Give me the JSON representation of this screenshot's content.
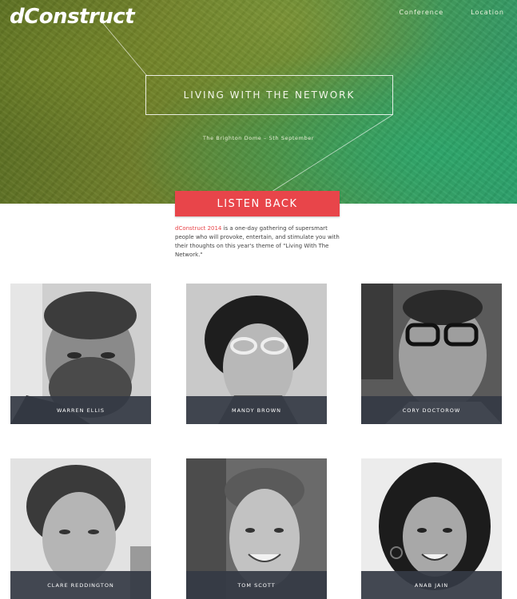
{
  "header": {
    "logo": "dConstruct",
    "nav": [
      {
        "label": "Conference"
      },
      {
        "label": "Location"
      }
    ]
  },
  "hero": {
    "title": "LIVING WITH THE NETWORK",
    "subtitle": "The Brighton Dome – 5th September",
    "cta_label": "LISTEN BACK"
  },
  "intro": {
    "brand": "dConstruct 2014",
    "text": " is a one-day gathering of supersmart people who will provoke, entertain, and stimulate you with their thoughts on this year's theme of \"Living With The Network.\""
  },
  "speakers": [
    {
      "name": "WARREN ELLIS"
    },
    {
      "name": "MANDY BROWN"
    },
    {
      "name": "CORY DOCTOROW"
    },
    {
      "name": "CLARE REDDINGTON"
    },
    {
      "name": "TOM SCOTT"
    },
    {
      "name": "ANAB JAIN"
    }
  ],
  "colors": {
    "accent": "#e8454a",
    "name_bar": "#343a44",
    "hero_green": "#4f8a33"
  }
}
